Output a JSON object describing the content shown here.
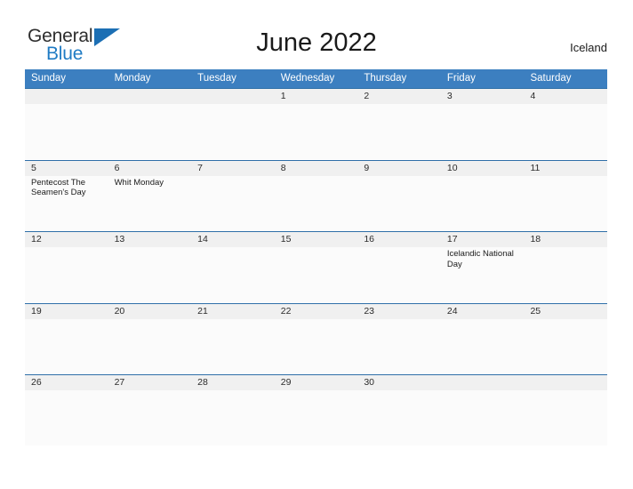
{
  "brand": {
    "name_part1": "General",
    "name_part2": "Blue",
    "triangle_icon": "blue-triangle-logo-mark",
    "accent_color": "#1c6fb4"
  },
  "header": {
    "title": "June 2022",
    "country": "Iceland"
  },
  "theme": {
    "header_blue": "#3c7fc0",
    "row_divider_blue": "#2f6fa8",
    "date_band_gray": "#f0f0f0",
    "cell_background": "#fbfbfb"
  },
  "weekdays": [
    "Sunday",
    "Monday",
    "Tuesday",
    "Wednesday",
    "Thursday",
    "Friday",
    "Saturday"
  ],
  "weeks": [
    [
      {
        "date": "",
        "event": ""
      },
      {
        "date": "",
        "event": ""
      },
      {
        "date": "",
        "event": ""
      },
      {
        "date": "1",
        "event": ""
      },
      {
        "date": "2",
        "event": ""
      },
      {
        "date": "3",
        "event": ""
      },
      {
        "date": "4",
        "event": ""
      }
    ],
    [
      {
        "date": "5",
        "event": "Pentecost  The Seamen's Day"
      },
      {
        "date": "6",
        "event": "Whit Monday"
      },
      {
        "date": "7",
        "event": ""
      },
      {
        "date": "8",
        "event": ""
      },
      {
        "date": "9",
        "event": ""
      },
      {
        "date": "10",
        "event": ""
      },
      {
        "date": "11",
        "event": ""
      }
    ],
    [
      {
        "date": "12",
        "event": ""
      },
      {
        "date": "13",
        "event": ""
      },
      {
        "date": "14",
        "event": ""
      },
      {
        "date": "15",
        "event": ""
      },
      {
        "date": "16",
        "event": ""
      },
      {
        "date": "17",
        "event": "Icelandic National Day"
      },
      {
        "date": "18",
        "event": ""
      }
    ],
    [
      {
        "date": "19",
        "event": ""
      },
      {
        "date": "20",
        "event": ""
      },
      {
        "date": "21",
        "event": ""
      },
      {
        "date": "22",
        "event": ""
      },
      {
        "date": "23",
        "event": ""
      },
      {
        "date": "24",
        "event": ""
      },
      {
        "date": "25",
        "event": ""
      }
    ],
    [
      {
        "date": "26",
        "event": ""
      },
      {
        "date": "27",
        "event": ""
      },
      {
        "date": "28",
        "event": ""
      },
      {
        "date": "29",
        "event": ""
      },
      {
        "date": "30",
        "event": ""
      },
      {
        "date": "",
        "event": ""
      },
      {
        "date": "",
        "event": ""
      }
    ]
  ]
}
